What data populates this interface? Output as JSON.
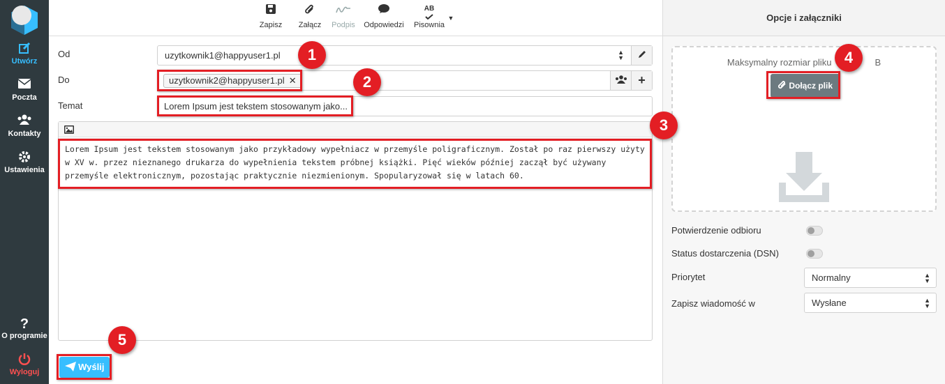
{
  "nav": {
    "items": [
      {
        "label": "Utwórz"
      },
      {
        "label": "Poczta"
      },
      {
        "label": "Kontakty"
      },
      {
        "label": "Ustawienia"
      }
    ],
    "about": "O programie",
    "logout": "Wyloguj"
  },
  "toolbar": {
    "save": "Zapisz",
    "attach": "Załącz",
    "signature": "Podpis",
    "responses": "Odpowiedzi",
    "spelling": "Pisownia",
    "spelling_icon_text": "AB"
  },
  "compose": {
    "from_label": "Od",
    "from_value": "uzytkownik1@happyuser1.pl",
    "to_label": "Do",
    "to_recipient": "uzytkownik2@happyuser1.pl",
    "subject_label": "Temat",
    "subject_value": "Lorem Ipsum jest tekstem stosowanym jako...",
    "body": "Lorem Ipsum jest tekstem stosowanym jako przykładowy wypełniacz w przemyśle poligraficznym. Został po raz pierwszy użyty w XV w. przez nieznanego drukarza do wypełnienia tekstem próbnej książki. Pięć wieków później zaczął być używany przemyśle elektronicznym, pozostając praktycznie niezmienionym. Spopularyzował się w latach 60.",
    "send": "Wyślij"
  },
  "panel": {
    "title": "Opcje i załączniki",
    "max_size_text": "Maksymalny rozmiar pliku",
    "max_size_suffix": "B",
    "attach_button": "Dołącz plik",
    "receipt_label": "Potwierdzenie odbioru",
    "dsn_label": "Status dostarczenia (DSN)",
    "priority_label": "Priorytet",
    "priority_value": "Normalny",
    "save_in_label": "Zapisz wiadomość w",
    "save_in_value": "Wysłane"
  },
  "annotations": [
    "1",
    "2",
    "3",
    "4",
    "5"
  ],
  "colors": {
    "nav_bg": "#2f3a3f",
    "accent": "#37beff",
    "logout": "#ff5050",
    "annotation_red": "#e31e24"
  }
}
